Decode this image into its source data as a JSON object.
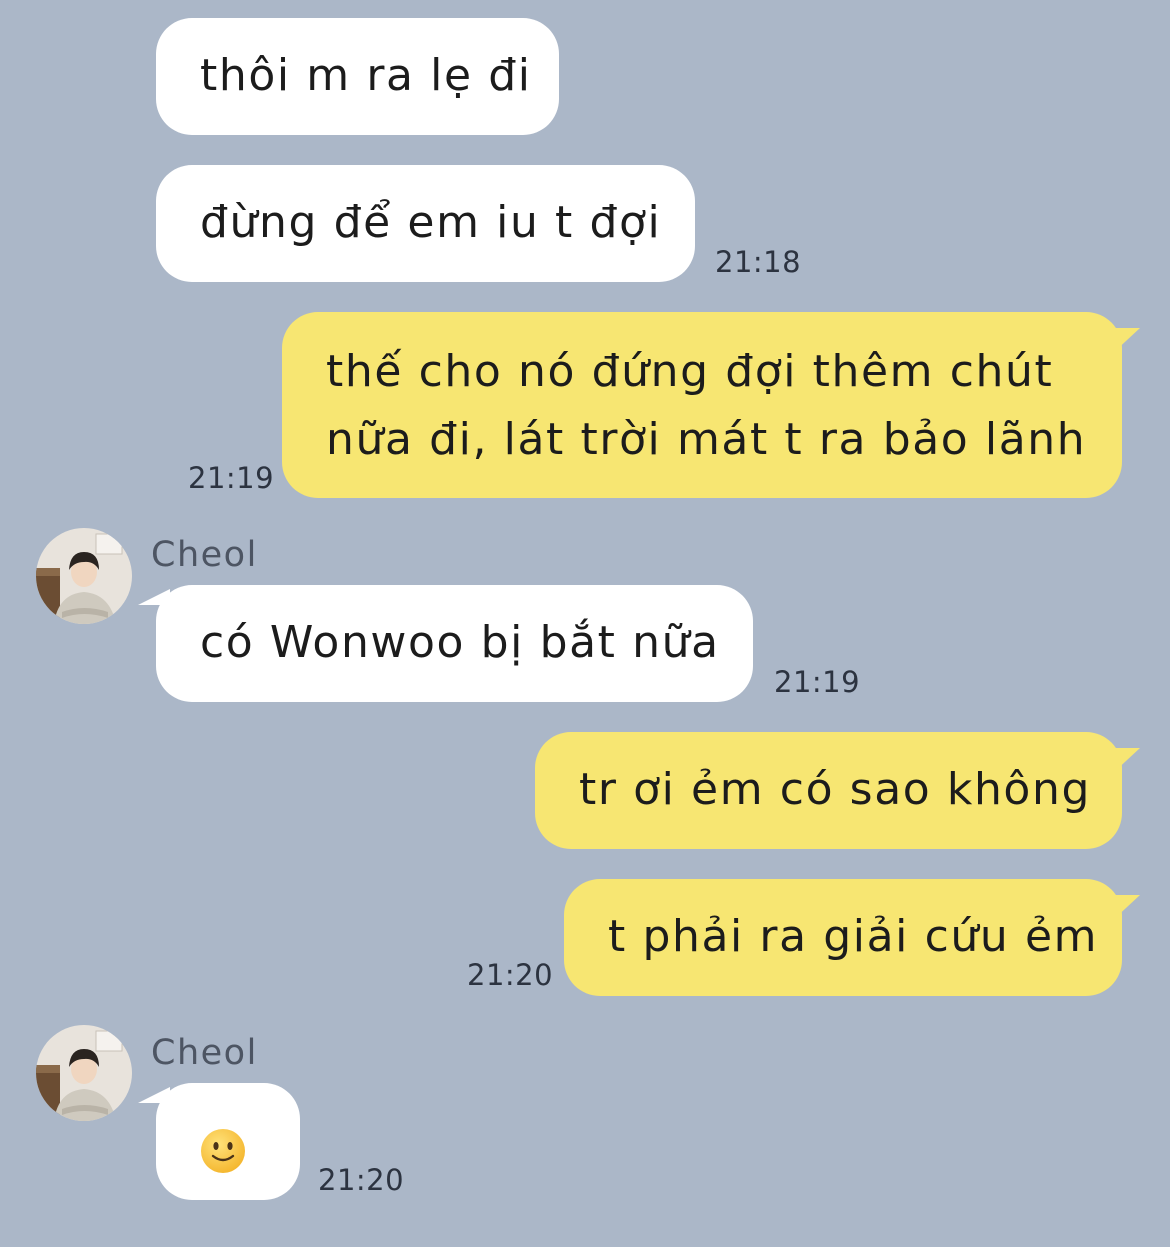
{
  "colors": {
    "background": "#abb7c8",
    "incoming_bubble": "#ffffff",
    "outgoing_bubble": "#f7e672"
  },
  "messages": [
    {
      "side": "incoming",
      "text": "thôi m ra lẹ đi"
    },
    {
      "side": "incoming",
      "text": "đừng để em iu t đợi",
      "time": "21:18"
    },
    {
      "side": "outgoing",
      "lines": [
        "thế cho nó đứng đợi thêm chút",
        "nữa đi, lát trời mát t ra bảo lãnh"
      ],
      "time": "21:19"
    },
    {
      "side": "incoming",
      "sender": "Cheol",
      "avatar": "user-avatar",
      "text": "có Wonwoo bị bắt nữa",
      "time": "21:19"
    },
    {
      "side": "outgoing",
      "text": "tr ơi ẻm có sao không"
    },
    {
      "side": "outgoing",
      "text": "t phải ra giải cứu ẻm",
      "time": "21:20"
    },
    {
      "side": "incoming",
      "sender": "Cheol",
      "avatar": "user-avatar",
      "emoji": "slightly-smiling-face",
      "time": "21:20"
    }
  ]
}
